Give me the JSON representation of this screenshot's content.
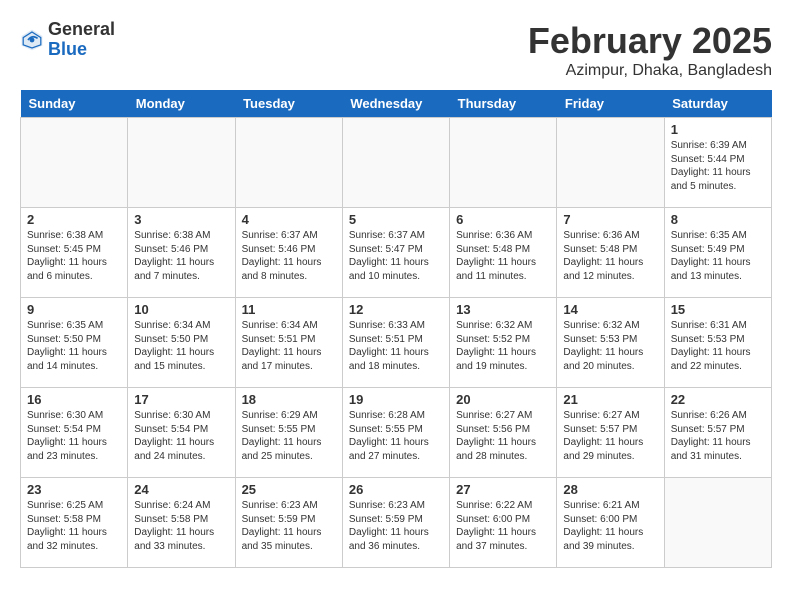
{
  "header": {
    "logo_general": "General",
    "logo_blue": "Blue",
    "month_year": "February 2025",
    "location": "Azimpur, Dhaka, Bangladesh"
  },
  "days_of_week": [
    "Sunday",
    "Monday",
    "Tuesday",
    "Wednesday",
    "Thursday",
    "Friday",
    "Saturday"
  ],
  "weeks": [
    [
      {
        "day": "",
        "info": ""
      },
      {
        "day": "",
        "info": ""
      },
      {
        "day": "",
        "info": ""
      },
      {
        "day": "",
        "info": ""
      },
      {
        "day": "",
        "info": ""
      },
      {
        "day": "",
        "info": ""
      },
      {
        "day": "1",
        "info": "Sunrise: 6:39 AM\nSunset: 5:44 PM\nDaylight: 11 hours\nand 5 minutes."
      }
    ],
    [
      {
        "day": "2",
        "info": "Sunrise: 6:38 AM\nSunset: 5:45 PM\nDaylight: 11 hours\nand 6 minutes."
      },
      {
        "day": "3",
        "info": "Sunrise: 6:38 AM\nSunset: 5:46 PM\nDaylight: 11 hours\nand 7 minutes."
      },
      {
        "day": "4",
        "info": "Sunrise: 6:37 AM\nSunset: 5:46 PM\nDaylight: 11 hours\nand 8 minutes."
      },
      {
        "day": "5",
        "info": "Sunrise: 6:37 AM\nSunset: 5:47 PM\nDaylight: 11 hours\nand 10 minutes."
      },
      {
        "day": "6",
        "info": "Sunrise: 6:36 AM\nSunset: 5:48 PM\nDaylight: 11 hours\nand 11 minutes."
      },
      {
        "day": "7",
        "info": "Sunrise: 6:36 AM\nSunset: 5:48 PM\nDaylight: 11 hours\nand 12 minutes."
      },
      {
        "day": "8",
        "info": "Sunrise: 6:35 AM\nSunset: 5:49 PM\nDaylight: 11 hours\nand 13 minutes."
      }
    ],
    [
      {
        "day": "9",
        "info": "Sunrise: 6:35 AM\nSunset: 5:50 PM\nDaylight: 11 hours\nand 14 minutes."
      },
      {
        "day": "10",
        "info": "Sunrise: 6:34 AM\nSunset: 5:50 PM\nDaylight: 11 hours\nand 15 minutes."
      },
      {
        "day": "11",
        "info": "Sunrise: 6:34 AM\nSunset: 5:51 PM\nDaylight: 11 hours\nand 17 minutes."
      },
      {
        "day": "12",
        "info": "Sunrise: 6:33 AM\nSunset: 5:51 PM\nDaylight: 11 hours\nand 18 minutes."
      },
      {
        "day": "13",
        "info": "Sunrise: 6:32 AM\nSunset: 5:52 PM\nDaylight: 11 hours\nand 19 minutes."
      },
      {
        "day": "14",
        "info": "Sunrise: 6:32 AM\nSunset: 5:53 PM\nDaylight: 11 hours\nand 20 minutes."
      },
      {
        "day": "15",
        "info": "Sunrise: 6:31 AM\nSunset: 5:53 PM\nDaylight: 11 hours\nand 22 minutes."
      }
    ],
    [
      {
        "day": "16",
        "info": "Sunrise: 6:30 AM\nSunset: 5:54 PM\nDaylight: 11 hours\nand 23 minutes."
      },
      {
        "day": "17",
        "info": "Sunrise: 6:30 AM\nSunset: 5:54 PM\nDaylight: 11 hours\nand 24 minutes."
      },
      {
        "day": "18",
        "info": "Sunrise: 6:29 AM\nSunset: 5:55 PM\nDaylight: 11 hours\nand 25 minutes."
      },
      {
        "day": "19",
        "info": "Sunrise: 6:28 AM\nSunset: 5:55 PM\nDaylight: 11 hours\nand 27 minutes."
      },
      {
        "day": "20",
        "info": "Sunrise: 6:27 AM\nSunset: 5:56 PM\nDaylight: 11 hours\nand 28 minutes."
      },
      {
        "day": "21",
        "info": "Sunrise: 6:27 AM\nSunset: 5:57 PM\nDaylight: 11 hours\nand 29 minutes."
      },
      {
        "day": "22",
        "info": "Sunrise: 6:26 AM\nSunset: 5:57 PM\nDaylight: 11 hours\nand 31 minutes."
      }
    ],
    [
      {
        "day": "23",
        "info": "Sunrise: 6:25 AM\nSunset: 5:58 PM\nDaylight: 11 hours\nand 32 minutes."
      },
      {
        "day": "24",
        "info": "Sunrise: 6:24 AM\nSunset: 5:58 PM\nDaylight: 11 hours\nand 33 minutes."
      },
      {
        "day": "25",
        "info": "Sunrise: 6:23 AM\nSunset: 5:59 PM\nDaylight: 11 hours\nand 35 minutes."
      },
      {
        "day": "26",
        "info": "Sunrise: 6:23 AM\nSunset: 5:59 PM\nDaylight: 11 hours\nand 36 minutes."
      },
      {
        "day": "27",
        "info": "Sunrise: 6:22 AM\nSunset: 6:00 PM\nDaylight: 11 hours\nand 37 minutes."
      },
      {
        "day": "28",
        "info": "Sunrise: 6:21 AM\nSunset: 6:00 PM\nDaylight: 11 hours\nand 39 minutes."
      },
      {
        "day": "",
        "info": ""
      }
    ]
  ]
}
